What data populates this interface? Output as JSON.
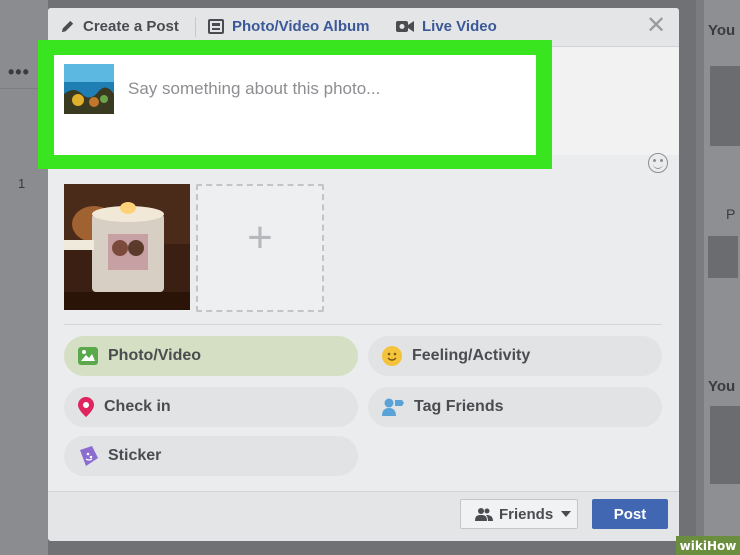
{
  "header": {
    "create_post": "Create a Post",
    "photo_album": "Photo/Video Album",
    "live_video": "Live Video"
  },
  "composer": {
    "placeholder": "Say something about this photo..."
  },
  "actions": [
    {
      "label": "Photo/Video",
      "icon": "photo-icon",
      "active": true
    },
    {
      "label": "Feeling/Activity",
      "icon": "smiley-icon"
    },
    {
      "label": "Check in",
      "icon": "location-pin-icon"
    },
    {
      "label": "Tag Friends",
      "icon": "tag-friends-icon"
    },
    {
      "label": "Sticker",
      "icon": "sticker-icon"
    }
  ],
  "footer": {
    "audience_label": "Friends",
    "post_label": "Post"
  },
  "background": {
    "right_title_top": "You",
    "right_title_bottom": "You",
    "right_mid_letter": "P",
    "left_number": "1",
    "left_dots": "•••"
  },
  "watermark": "wikiHow",
  "colors": {
    "highlight": "#39e51f",
    "facebook_blue": "#3b5998",
    "post_button": "#4267b2",
    "active_action": "#d4dfc3"
  }
}
